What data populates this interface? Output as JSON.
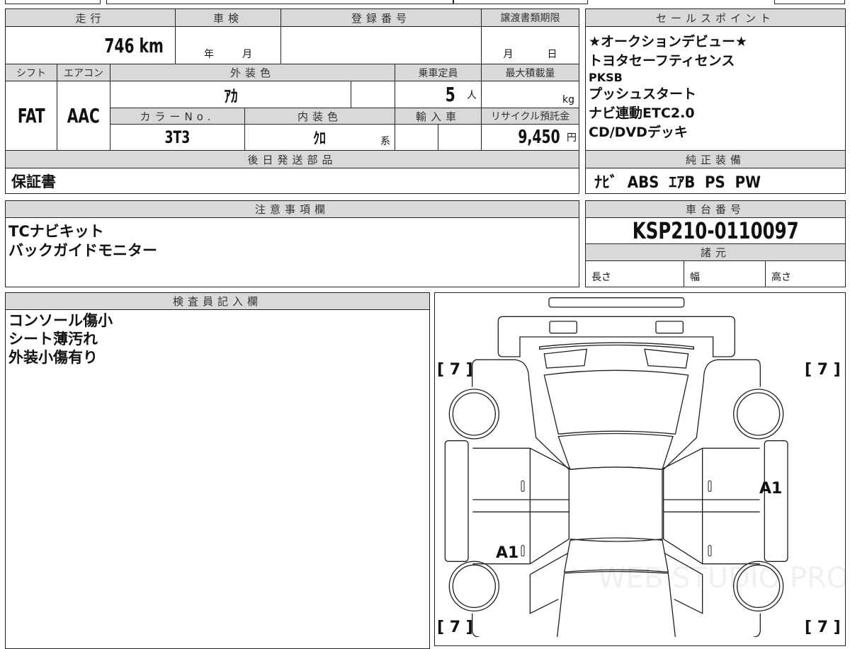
{
  "vehicle_info": {
    "mileage_label": "走行",
    "mileage_value": "746 km",
    "inspection_label": "車検",
    "inspection_year": "年",
    "inspection_month": "月",
    "registration_label": "登録番号",
    "transfer_deadline_label": "譲渡書類期限",
    "transfer_month": "月",
    "transfer_day": "日",
    "shift_label": "シフト",
    "shift_value": "FAT",
    "ac_label": "エアコン",
    "ac_value": "AAC",
    "exterior_color_label": "外装色",
    "exterior_color_value": "ｱｶ",
    "capacity_label": "乗車定員",
    "capacity_value": "5",
    "capacity_unit": "人",
    "max_load_label": "最大積載量",
    "max_load_unit": "kg",
    "color_no_label": "カラーNo.",
    "color_no_value": "3T3",
    "interior_color_label": "内装色",
    "interior_color_value": "ｸﾛ",
    "interior_color_suffix": "系",
    "import_label": "輸入車",
    "recycle_label": "リサイクル預託金",
    "recycle_value": "9,450",
    "recycle_unit": "円",
    "later_parts_label": "後日発送部品",
    "later_parts_value": "保証書"
  },
  "sales_points": {
    "label": "セールスポイント",
    "items": [
      "★オークションデビュー★",
      "トヨタセーフティセンス",
      "PKSB",
      "プッシュスタート",
      "ナビ連動ETC2.0",
      "CD/DVDデッキ"
    ]
  },
  "standard_equipment": {
    "label": "純正装備",
    "value": "ﾅﾋﾞ  ABS  ｴｱB  PS  PW"
  },
  "notes": {
    "label": "注意事項欄",
    "items": [
      "TCナビキット",
      "バックガイドモニター"
    ]
  },
  "chassis": {
    "label": "車台番号",
    "value": "KSP210-0110097",
    "specs_label": "諸元",
    "length": "長さ",
    "width": "幅",
    "height": "高さ"
  },
  "inspector": {
    "label": "検査員記入欄",
    "items": [
      "コンソール傷小",
      "シート薄汚れ",
      "外装小傷有り"
    ]
  },
  "diagram": {
    "tire_tread": [
      "[ 7 ]",
      "[ 7 ]",
      "[ 7 ]",
      "[ 7 ]"
    ],
    "marks": [
      "A1",
      "A1"
    ],
    "door_marks": [
      "0",
      "0",
      "0",
      "0"
    ],
    "watermark": "WEB STUDIO PRO"
  }
}
